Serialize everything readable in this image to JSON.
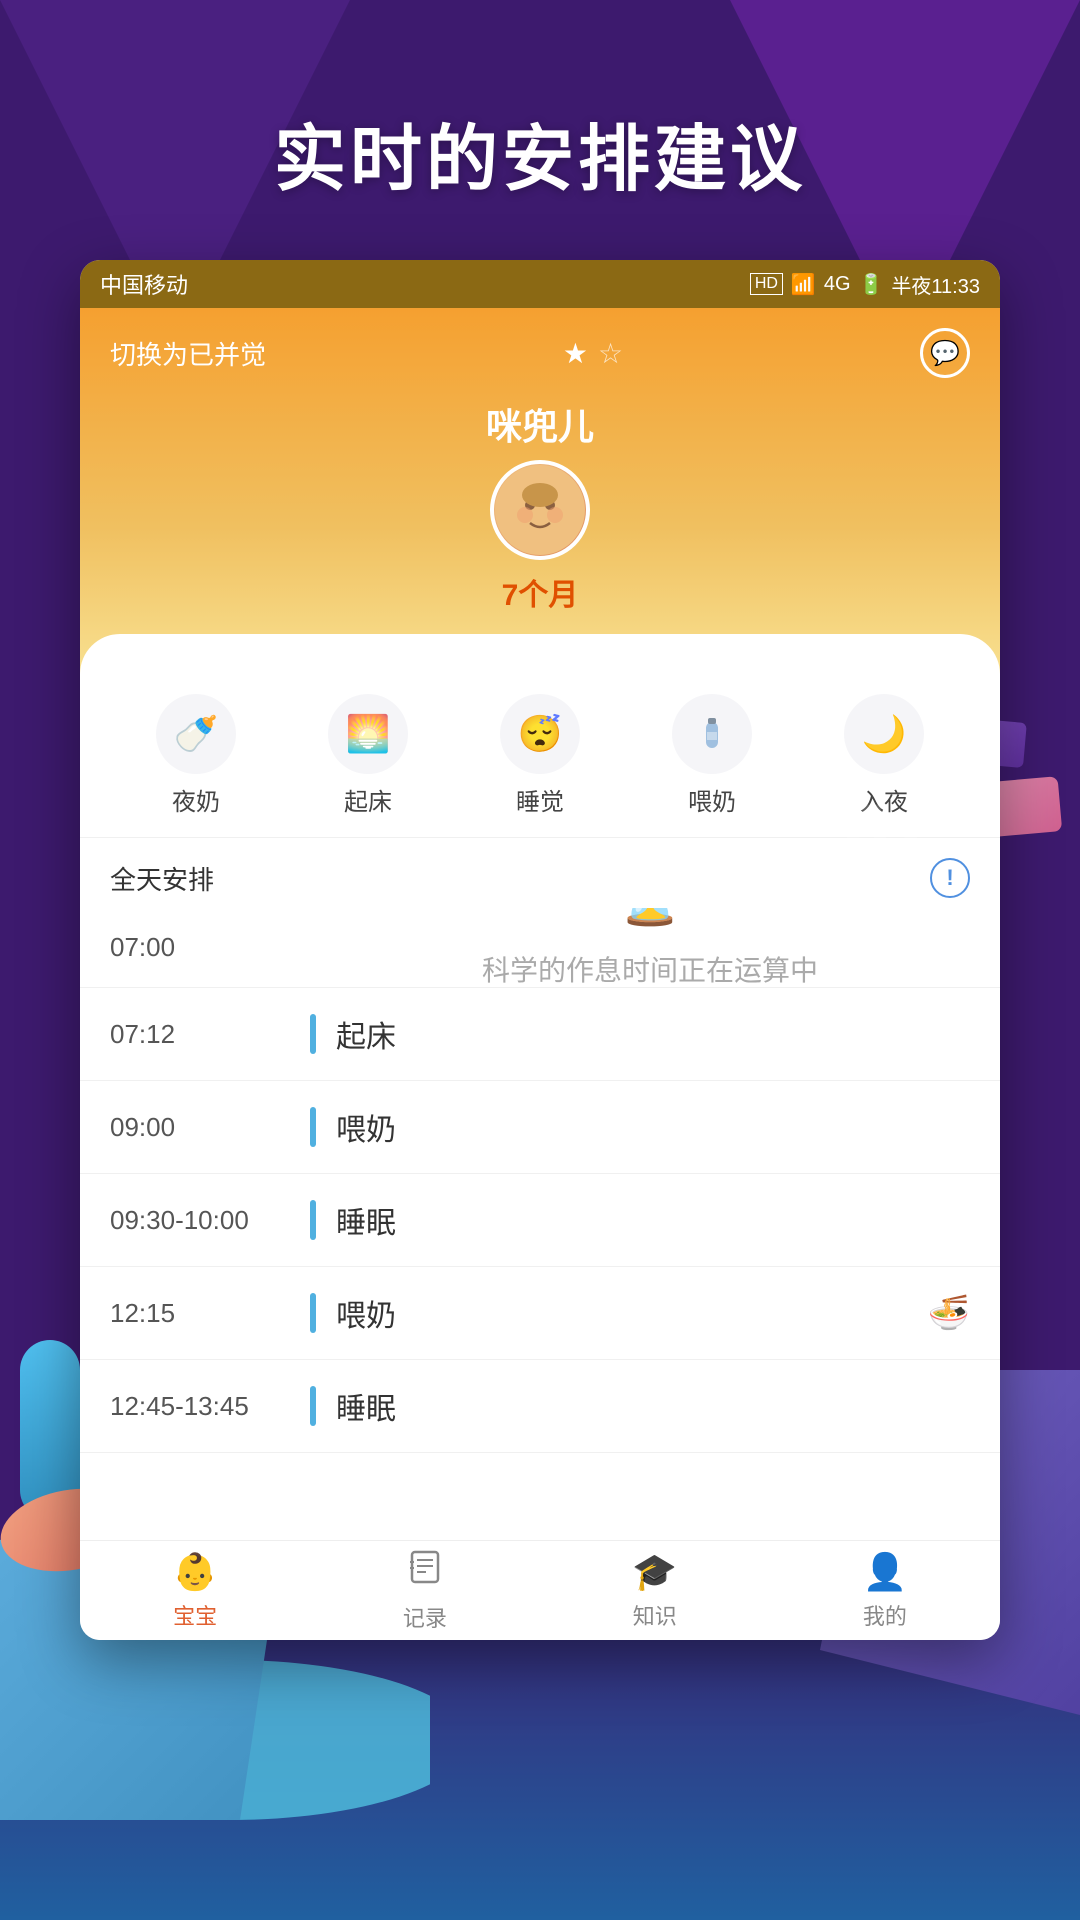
{
  "background": {
    "color": "#3d1a6e"
  },
  "main_title": "实时的安排建议",
  "status_bar": {
    "carrier": "中国移动",
    "hd": "HD",
    "wifi": "WiFi",
    "signal": "4G",
    "battery": "■",
    "time": "半夜11:33"
  },
  "header": {
    "switch_btn": "切换为已并觉",
    "stars": [
      "★",
      "☆"
    ],
    "baby_name": "咪兜儿",
    "baby_age": "7个月"
  },
  "quick_actions": [
    {
      "icon": "🍼",
      "label": "夜奶"
    },
    {
      "icon": "🌅",
      "label": "起床"
    },
    {
      "icon": "😴",
      "label": "睡觉"
    },
    {
      "icon": "🍼",
      "label": "喂奶"
    },
    {
      "icon": "🌙",
      "label": "入夜"
    }
  ],
  "schedule": {
    "title": "全天安排",
    "loading_text": "科学的作息时间正在运算中\n请稍后...",
    "items": [
      {
        "time": "07:00",
        "event": "",
        "has_edit": true
      },
      {
        "time": "07:12",
        "event": "起床",
        "has_edit": false
      },
      {
        "time": "09:00",
        "event": "喂奶",
        "has_bowl": false
      },
      {
        "time": "09:30-10:00",
        "event": "睡眠",
        "has_bowl": false
      },
      {
        "time": "12:15",
        "event": "喂奶",
        "has_bowl": true
      },
      {
        "time": "12:45-13:45",
        "event": "睡眠",
        "has_bowl": false
      }
    ]
  },
  "bottom_nav": [
    {
      "icon": "👶",
      "label": "宝宝",
      "active": true
    },
    {
      "icon": "📋",
      "label": "记录",
      "active": false
    },
    {
      "icon": "🎓",
      "label": "知识",
      "active": false
    },
    {
      "icon": "👤",
      "label": "我的",
      "active": false
    }
  ]
}
